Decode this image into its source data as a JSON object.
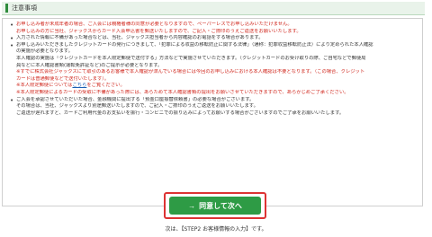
{
  "header": {
    "title": "注意事項"
  },
  "notice": {
    "items": [
      {
        "color": "#d0271d",
        "lines": [
          "お申し込み者が未成年者の場合、ご入会には親権者様の同意が必要となりますので、ペーパーレスでお申し込みいただけません。",
          "お申し込みの方に当社、ジャックスからカード入会申込書を郵送いたしますので、ご記入・ご捺印のうえご返送をお願いいたします。"
        ]
      },
      {
        "color": "#333333",
        "lines": [
          "入力された情報に不備があった場合などは、当社、ジャックス担当者から内容確認のお電話をする場合があります。"
        ]
      },
      {
        "color": "#333333",
        "lines": [
          "お申し込みいただきましたクレジットカードの発行につきまして、「犯罪による収益の移転防止に関する法律」（通称：犯罪収益移転防止法）により定められた本人確認",
          "の実施が必要となります。",
          "本人確認の実施は「クレジットカードを本人限定郵便で送付する」方法などで実施させていただきます。（クレジットカードのお受け取りの際、ご自宅などで郵便局",
          "員などに本人確認書類(運転免許証など)のご提示が必要となります。"
        ],
        "warn": [
          "※すでに株式会社ジャックスにて取引のあるお客様で本人確認が済んでいる場合には今回のお申し込みにおける本人確認は不要となります。（この場合、クレジット",
          "カードは普通郵便などで送付いたします）。"
        ],
        "link_prefix": "※本人限定郵便については",
        "link_text": "こちら",
        "link_suffix": "をご覧ください。",
        "extra": [
          "※本人限定郵便によるカードの受取に不備があった際には、あらためて本人確認書類の提出をお願いさせていただきますので、あらかじめご了承ください。"
        ]
      },
      {
        "color": "#333333",
        "lines": [
          "ご入会を承認させていただいた場合、金融機関に提出する「預金口座振替依頼書」の必要な場合がございます。",
          "その場合は、当社、ジャックスより別途郵送いたしますので、ご記入・ご捺印のうえご返送をお願いいたします。",
          "ご返送が遅れますと、カードご利用代金のお支払いを振行・コンビニでの振り込みによってお願いする場合がございますのでご了承をお願いいたします。"
        ]
      }
    ]
  },
  "button": {
    "label": "同意して次へ",
    "arrow": "→"
  },
  "next_step": {
    "text": "次は、【STEP2 お客様情報の入力】です。"
  },
  "colors": {
    "accent": "#2e9b45",
    "warning": "#d0271d",
    "highlight_border": "#dd3333"
  }
}
